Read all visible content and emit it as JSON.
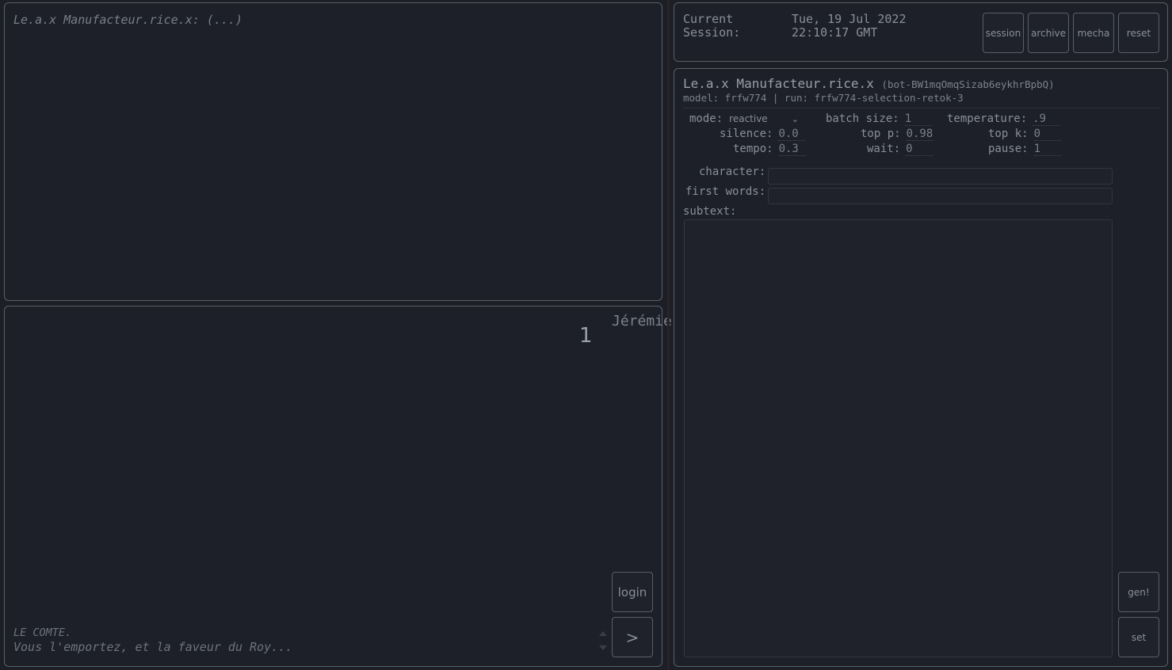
{
  "log": {
    "line": "Le.a.x Manufacteur.rice.x: (...)"
  },
  "chat": {
    "speaker_count": "1",
    "speaker_name": "Jérémie",
    "login_label": "login",
    "send_label": ">",
    "prompt_speaker": "LE COMTE.",
    "prompt_line": "Vous l'emportez, et la faveur du Roy..."
  },
  "session": {
    "label": "Current Session:",
    "date_line1": "Tue, 19 Jul 2022",
    "date_line2": "22:10:17 GMT",
    "buttons": {
      "session": "session",
      "archive": "archive",
      "mecha": "mecha",
      "reset": "reset"
    }
  },
  "bot": {
    "name": "Le.a.x Manufacteur.rice.x",
    "id": "(bot-BW1mqOmqSizab6eykhrBpbQ)",
    "subtitle": "model: frfw774 | run: frfw774-selection-retok-3",
    "params": {
      "mode_label": "mode:",
      "mode_value": "reactive",
      "batch_size_label": "batch size:",
      "batch_size_value": "1",
      "temperature_label": "temperature:",
      "temperature_value": ".9",
      "silence_label": "silence:",
      "silence_value": "0.0",
      "top_p_label": "top p:",
      "top_p_value": "0.98",
      "top_k_label": "top k:",
      "top_k_value": "0",
      "tempo_label": "tempo:",
      "tempo_value": "0.3",
      "wait_label": "wait:",
      "wait_value": "0",
      "pause_label": "pause:",
      "pause_value": "1"
    },
    "fields": {
      "character_label": "character:",
      "first_words_label": "first words:",
      "subtext_label": "subtext:"
    },
    "buttons": {
      "gen": "gen!",
      "set": "set"
    }
  }
}
